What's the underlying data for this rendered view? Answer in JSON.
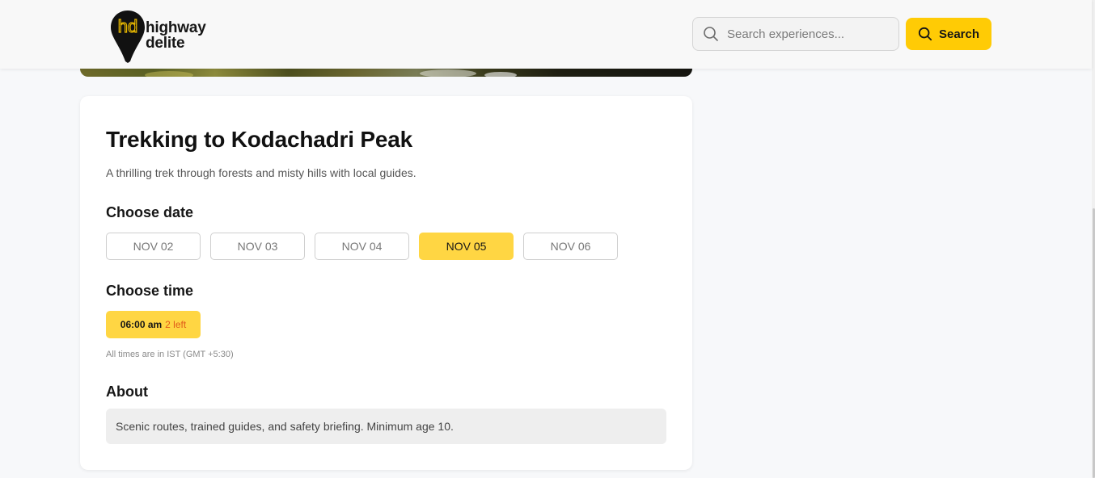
{
  "header": {
    "logo_line1": "highway",
    "logo_line2": "delite",
    "logo_mark": "hd",
    "search_placeholder": "Search experiences...",
    "search_button_label": "Search"
  },
  "experience": {
    "title": "Trekking to Kodachadri Peak",
    "description": "A thrilling trek through forests and misty hills with local guides.",
    "choose_date_label": "Choose date",
    "dates": [
      "NOV 02",
      "NOV 03",
      "NOV 04",
      "NOV 05",
      "NOV 06"
    ],
    "selected_date": "NOV 05",
    "choose_time_label": "Choose time",
    "time_slot": {
      "time": "06:00 am",
      "availability": "2 left"
    },
    "timezone_note": "All times are in IST (GMT +5:30)",
    "about_label": "About",
    "about_text": "Scenic routes, trained guides, and safety briefing. Minimum age 10."
  },
  "colors": {
    "accent": "#ffcb05",
    "selected_chip": "#ffd643",
    "availability_text": "#e05b1a"
  },
  "icons": [
    "logo-pin-icon",
    "search-icon"
  ]
}
